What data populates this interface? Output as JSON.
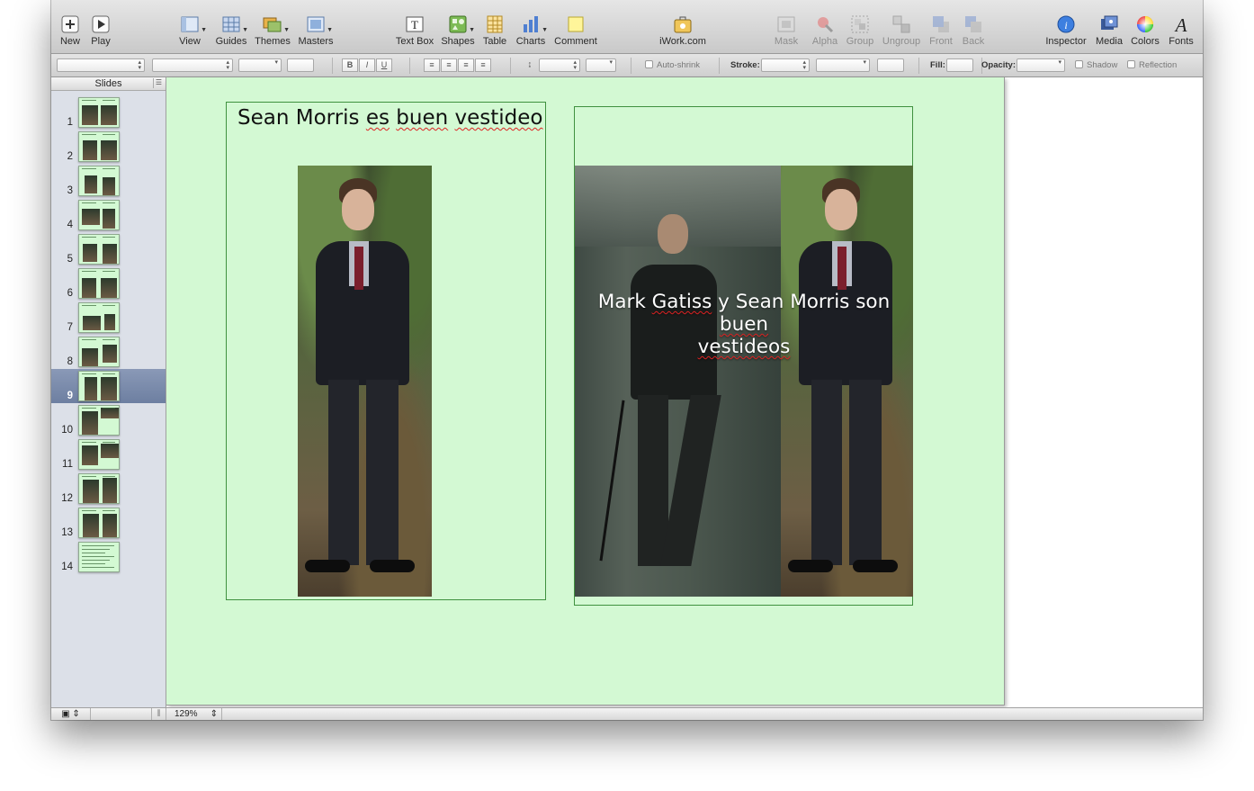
{
  "toolbar": {
    "new": "New",
    "play": "Play",
    "view": "View",
    "guides": "Guides",
    "themes": "Themes",
    "masters": "Masters",
    "text_box": "Text Box",
    "shapes": "Shapes",
    "table": "Table",
    "charts": "Charts",
    "comment": "Comment",
    "iwork": "iWork.com",
    "mask": "Mask",
    "alpha": "Alpha",
    "group": "Group",
    "ungroup": "Ungroup",
    "front": "Front",
    "back": "Back",
    "inspector": "Inspector",
    "media": "Media",
    "colors": "Colors",
    "fonts": "Fonts"
  },
  "format_bar": {
    "bold": "B",
    "italic": "I",
    "underline": "U",
    "auto_shrink": "Auto-shrink",
    "stroke": "Stroke:",
    "fill": "Fill:",
    "opacity": "Opacity:",
    "shadow": "Shadow",
    "reflection": "Reflection"
  },
  "sidebar": {
    "header": "Slides",
    "slides": [
      {
        "num": "1"
      },
      {
        "num": "2"
      },
      {
        "num": "3"
      },
      {
        "num": "4"
      },
      {
        "num": "5"
      },
      {
        "num": "6"
      },
      {
        "num": "7"
      },
      {
        "num": "8"
      },
      {
        "num": "9",
        "selected": true
      },
      {
        "num": "10"
      },
      {
        "num": "11"
      },
      {
        "num": "12"
      },
      {
        "num": "13"
      },
      {
        "num": "14"
      }
    ]
  },
  "slide": {
    "title_words": [
      "Sean Morris",
      "es",
      "buen",
      "vestideo"
    ],
    "caption_line1_a": "Mark ",
    "caption_gatiss": "Gatiss",
    "caption_line1_b": " y Sean Morris son ",
    "caption_buen": "buen",
    "caption_line2": "vestideos",
    "background": "#d3f9d3"
  },
  "status": {
    "zoom": "129%"
  }
}
